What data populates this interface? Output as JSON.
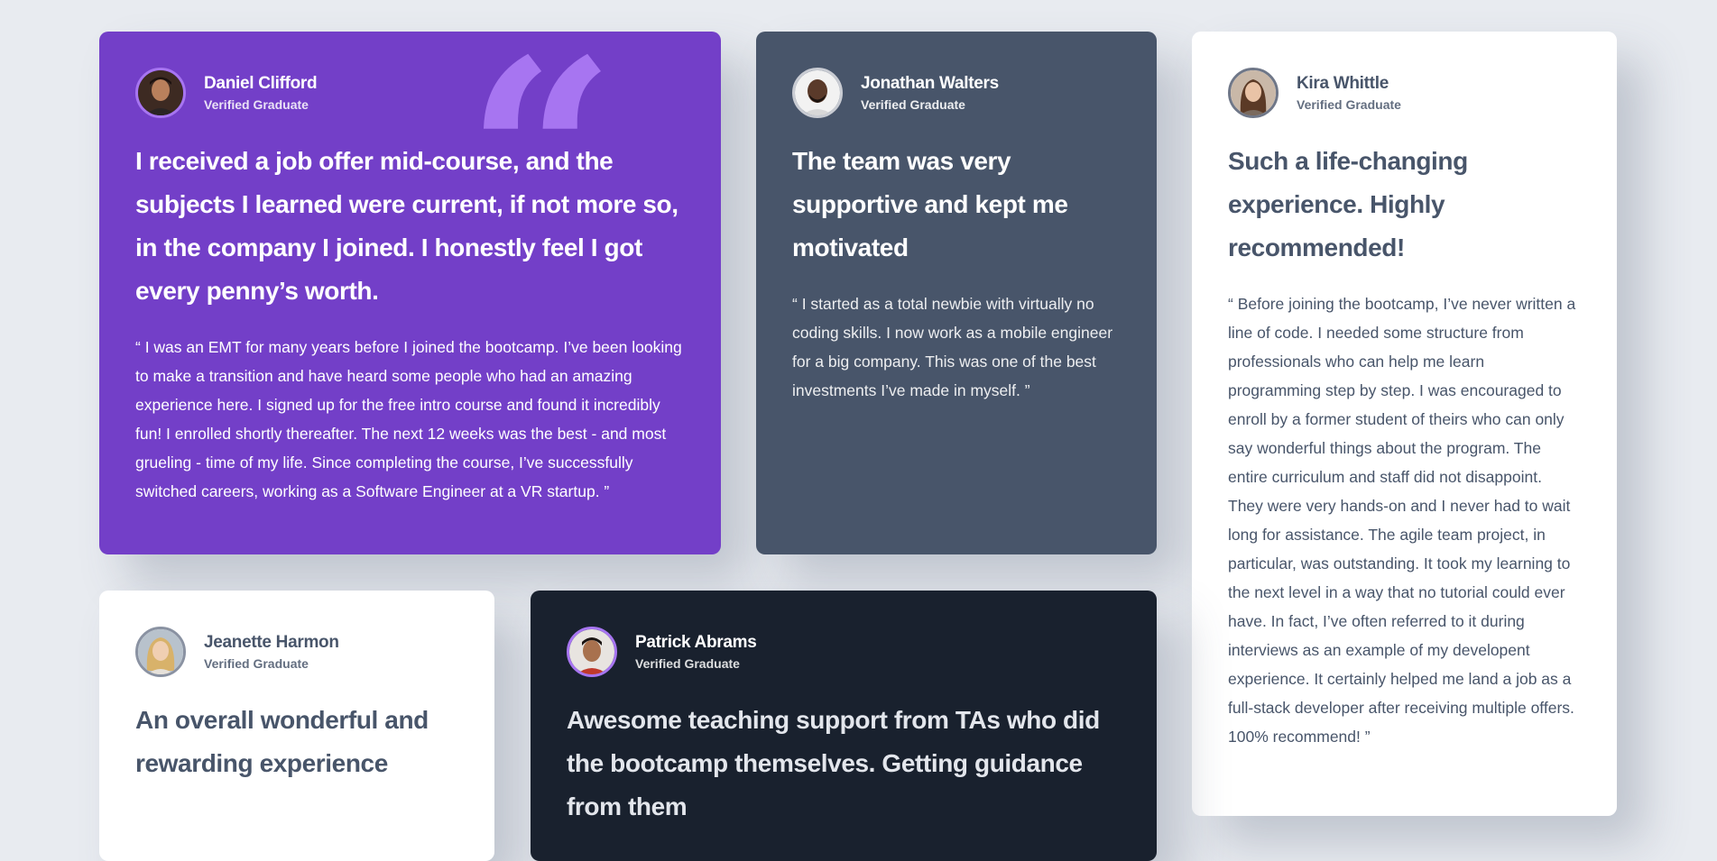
{
  "testimonials": [
    {
      "name": "Daniel Clifford",
      "status": "Verified Graduate",
      "headline": "I received a job offer mid-course, and the subjects I learned were current, if not more so, in the company I joined. I honestly feel I got every penny’s worth.",
      "quote": "“ I was an EMT for many years before I joined the bootcamp. I’ve been looking to make a transition and have heard some people who had an amazing experience here. I signed up for the free intro course and found it incredibly fun! I enrolled shortly thereafter. The next 12 weeks was the best - and most grueling - time of my life. Since completing the course, I’ve successfully switched careers, working as a Software Engineer at a VR startup. ”"
    },
    {
      "name": "Jonathan Walters",
      "status": "Verified Graduate",
      "headline": "The team was very supportive and kept me motivated",
      "quote": "“ I started as a total newbie with virtually no coding skills. I now work as a mobile engineer for a big company. This was one of the best investments I’ve made in myself. ”"
    },
    {
      "name": "Kira Whittle",
      "status": "Verified Graduate",
      "headline": "Such a life-changing experience. Highly recommended!",
      "quote": "“ Before joining the bootcamp, I’ve never written a line of code. I needed some structure from professionals who can help me learn programming step by step. I was encouraged to enroll by a former student of theirs who can only say wonderful things about the program. The entire curriculum and staff did not disappoint. They were very hands-on and I never had to wait long for assistance. The agile team project, in particular, was outstanding. It took my learning to the next level in a way that no tutorial could ever have. In fact, I’ve often referred to it during interviews as an example of my developent experience. It certainly helped me land a job as a full-stack developer after receiving multiple offers. 100% recommend! ”"
    },
    {
      "name": "Jeanette Harmon",
      "status": "Verified Graduate",
      "headline": "An overall wonderful and rewarding experience"
    },
    {
      "name": "Patrick Abrams",
      "status": "Verified Graduate",
      "headline": "Awesome teaching support from TAs who did the bootcamp themselves. Getting guidance from them"
    }
  ],
  "decor": {
    "quote_icon": "quotation-mark-icon",
    "quote_glyph": "“"
  },
  "colors": {
    "background": "#e8ebf0",
    "purple_card": "#733fc8",
    "slate_card": "#48556a",
    "white_card": "#ffffff",
    "dark_card": "#19212e",
    "accent": "#a775f1"
  }
}
